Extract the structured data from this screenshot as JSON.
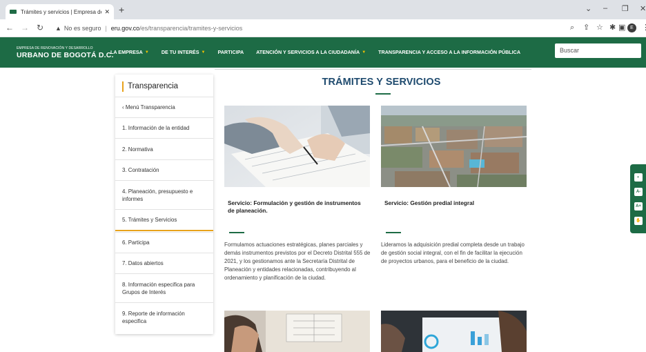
{
  "browser": {
    "tab_title": "Trámites y servicios | Empresa de",
    "tab_close": "✕",
    "new_tab": "+",
    "security_label": "No es seguro",
    "separator": "|",
    "url_host": "eru.gov.co",
    "url_path": "/es/transparencia/tramites-y-servicios",
    "profile_initial": "E"
  },
  "header": {
    "logo_top": "EMPRESA DE RENOVACIÓN Y DESARROLLO",
    "logo_main": "URBANO DE BOGOTÁ D.C.",
    "nav": [
      {
        "label": "LA EMPRESA",
        "dropdown": true
      },
      {
        "label": "DE TU INTERÉS",
        "dropdown": true
      },
      {
        "label": "PARTICIPA",
        "dropdown": false
      },
      {
        "label": "ATENCIÓN Y SERVICIOS A LA CIUDADANÍA",
        "dropdown": true
      },
      {
        "label": "TRANSPARENCIA Y ACCESO A LA INFORMACIÓN PÚBLICA",
        "dropdown": false
      }
    ],
    "search_placeholder": "Buscar"
  },
  "sidebar": {
    "title": "Transparencia",
    "items": [
      {
        "label": "‹ Menú Transparencia"
      },
      {
        "label": "1. Información de la entidad"
      },
      {
        "label": "2. Normativa"
      },
      {
        "label": "3. Contratación"
      },
      {
        "label": "4. Planeación, presupuesto e informes"
      },
      {
        "label": "5. Trámites y Servicios"
      },
      {
        "label": "6. Participa"
      },
      {
        "label": "7. Datos abiertos"
      },
      {
        "label": "8. Información especifica para Grupos de Interés"
      },
      {
        "label": "9. Reporte de información especifica"
      }
    ]
  },
  "content": {
    "title": "TRÁMITES Y SERVICIOS",
    "cards": [
      {
        "title": "Servicio: Formulación y gestión de instrumentos de planeación.",
        "text": "Formulamos actuaciones estratégicas, planes parciales y demás instrumentos previstos por el Decreto Distrital 555 de 2021, y los gestionamos ante la Secretaría Distrital de Planeación y entidades relacionadas, contribuyendo al ordenamiento y planificación de la ciudad."
      },
      {
        "title": "Servicio: Gestión predial integral",
        "text": "Lideramos la adquisición predial completa desde un trabajo de gestión social integral, con el fin de facilitar la ejecución de proyectos urbanos, para el beneficio de la ciudad."
      }
    ]
  },
  "accessibility": {
    "font_decrease": "A-",
    "font_increase": "A+"
  }
}
